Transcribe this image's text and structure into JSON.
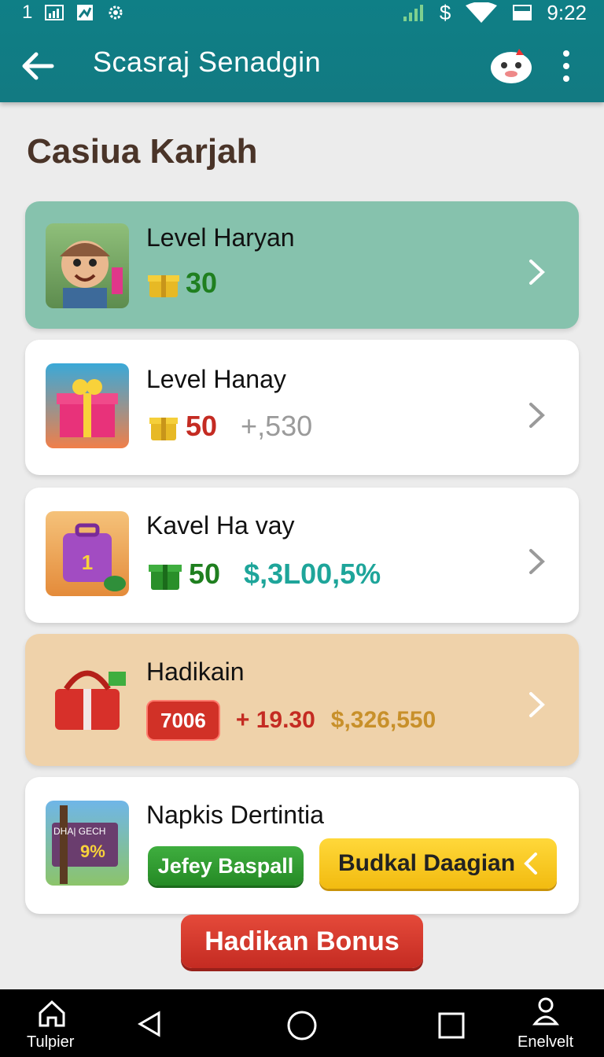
{
  "status_bar": {
    "left_text": "1",
    "time": "9:22"
  },
  "app_bar": {
    "title": "Scasraj Senadgin"
  },
  "page": {
    "heading": "Casiua Karjah"
  },
  "cards": [
    {
      "title": "Level Haryan",
      "value": "30",
      "extra": ""
    },
    {
      "title": "Level Hanay",
      "value": "50",
      "extra": "+,530"
    },
    {
      "title": "Kavel Ha vay",
      "value": "50",
      "extra": "$,3L00,5%"
    },
    {
      "title": "Hadikain",
      "badge": "7006",
      "extra1": "+ 19.30",
      "extra2": "$,326,550"
    },
    {
      "title": "Napkis Dertintia",
      "button1": "Jefey Baspall",
      "button2": "Budkal Daagian",
      "thumb_sign_text": "DHA| GECH",
      "thumb_sign_num": "9%"
    }
  ],
  "bonus_button": "Hadikan Bonus",
  "nav": {
    "left_label": "Tulpier",
    "right_label": "Enelvelt"
  },
  "colors": {
    "teal": "#127a82",
    "green_card": "#86c2ad",
    "tan_card": "#efd2aa",
    "red": "#c42b22",
    "green_text": "#1f8a1f",
    "teal_text": "#1ea59a",
    "gold_text": "#c8902a"
  }
}
